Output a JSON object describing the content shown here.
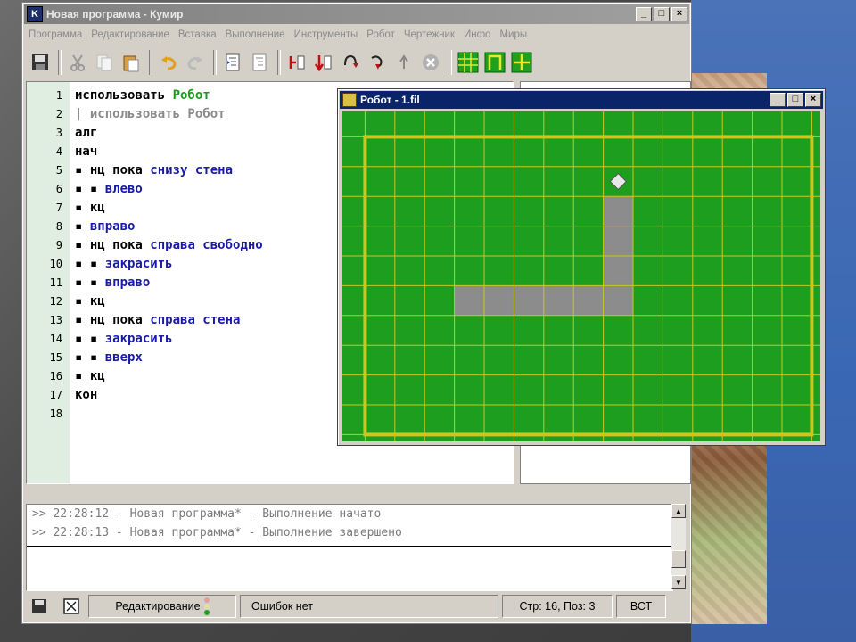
{
  "window": {
    "title": "Новая программа - Кумир",
    "logo_letter": "K",
    "btn_min": "_",
    "btn_max": "□",
    "btn_close": "×"
  },
  "menu": [
    "Программа",
    "Редактирование",
    "Вставка",
    "Выполнение",
    "Инструменты",
    "Робот",
    "Чертежник",
    "Инфо",
    "Миры"
  ],
  "toolbar_icons": [
    "save-icon",
    "cut-icon",
    "copy-icon",
    "paste-icon",
    "undo-icon",
    "redo-icon",
    "indent-icon",
    "unindent-icon",
    "run-icon",
    "step-icon",
    "step-over-icon",
    "step-into-icon",
    "step-out-icon",
    "stop-icon",
    "robot-grid-icon",
    "robot-frame-icon",
    "robot-cross-icon"
  ],
  "editor": {
    "lines": [
      {
        "num": "1",
        "tokens": [
          {
            "t": "использовать ",
            "c": "kw"
          },
          {
            "t": "Робот",
            "c": "grn"
          }
        ]
      },
      {
        "num": "2",
        "tokens": [
          {
            "t": "| использовать Робот",
            "c": "cmt"
          }
        ]
      },
      {
        "num": "3",
        "tokens": [
          {
            "t": "алг",
            "c": "kw"
          }
        ]
      },
      {
        "num": "4",
        "tokens": [
          {
            "t": "нач",
            "c": "kw"
          }
        ]
      },
      {
        "num": "5",
        "tokens": [
          {
            "t": "▪ ",
            "c": "dot"
          },
          {
            "t": "нц пока ",
            "c": "kw"
          },
          {
            "t": "снизу стена",
            "c": "cond"
          }
        ]
      },
      {
        "num": "6",
        "tokens": [
          {
            "t": "▪ ▪ ",
            "c": "dot"
          },
          {
            "t": "влево",
            "c": "cmd"
          }
        ]
      },
      {
        "num": "7",
        "tokens": [
          {
            "t": "▪ ",
            "c": "dot"
          },
          {
            "t": "кц",
            "c": "kw"
          }
        ]
      },
      {
        "num": "8",
        "tokens": [
          {
            "t": "▪ ",
            "c": "dot"
          },
          {
            "t": "вправо",
            "c": "cmd"
          }
        ]
      },
      {
        "num": "9",
        "tokens": [
          {
            "t": "▪ ",
            "c": "dot"
          },
          {
            "t": "нц пока ",
            "c": "kw"
          },
          {
            "t": "справа свободно",
            "c": "cond"
          }
        ]
      },
      {
        "num": "10",
        "tokens": [
          {
            "t": "▪ ▪ ",
            "c": "dot"
          },
          {
            "t": "закрасить",
            "c": "cmd"
          }
        ]
      },
      {
        "num": "11",
        "tokens": [
          {
            "t": "▪ ▪ ",
            "c": "dot"
          },
          {
            "t": "вправо",
            "c": "cmd"
          }
        ]
      },
      {
        "num": "12",
        "tokens": [
          {
            "t": "▪ ",
            "c": "dot"
          },
          {
            "t": "кц",
            "c": "kw"
          }
        ]
      },
      {
        "num": "13",
        "tokens": [
          {
            "t": "▪ ",
            "c": "dot"
          },
          {
            "t": "нц пока ",
            "c": "kw"
          },
          {
            "t": "справа стена",
            "c": "cond"
          }
        ]
      },
      {
        "num": "14",
        "tokens": [
          {
            "t": "▪ ▪ ",
            "c": "dot"
          },
          {
            "t": "закрасить",
            "c": "cmd"
          }
        ]
      },
      {
        "num": "15",
        "tokens": [
          {
            "t": "▪ ▪ ",
            "c": "dot"
          },
          {
            "t": "вверх",
            "c": "cmd"
          }
        ]
      },
      {
        "num": "16",
        "tokens": [
          {
            "t": "▪ ",
            "c": "dot"
          },
          {
            "t": "кц",
            "c": "kw"
          }
        ]
      },
      {
        "num": "17",
        "tokens": [
          {
            "t": "кон",
            "c": "kw"
          }
        ]
      },
      {
        "num": "18",
        "tokens": []
      }
    ]
  },
  "log": {
    "lines": [
      ">> 22:28:12 - Новая программа* - Выполнение начато",
      ">> 22:28:13 - Новая программа* - Выполнение завершено"
    ]
  },
  "status": {
    "mode": "Редактирование",
    "errors": "Ошибок нет",
    "position": "Стр: 16, Поз: 3",
    "insert": "ВСТ"
  },
  "robot_window": {
    "title": "Робот - 1.fil",
    "btn_min": "_",
    "btn_max": "□",
    "btn_close": "×",
    "colors": {
      "field": "#1e9e1e",
      "grid": "#c8c820",
      "painted": "#8c8c8c",
      "robot": "#e8e8e8"
    },
    "painted_cells": [
      [
        9,
        3
      ],
      [
        9,
        4
      ],
      [
        9,
        5
      ],
      [
        4,
        6
      ],
      [
        5,
        6
      ],
      [
        6,
        6
      ],
      [
        7,
        6
      ],
      [
        8,
        6
      ],
      [
        9,
        6
      ]
    ],
    "robot_cell": [
      9,
      2
    ]
  }
}
